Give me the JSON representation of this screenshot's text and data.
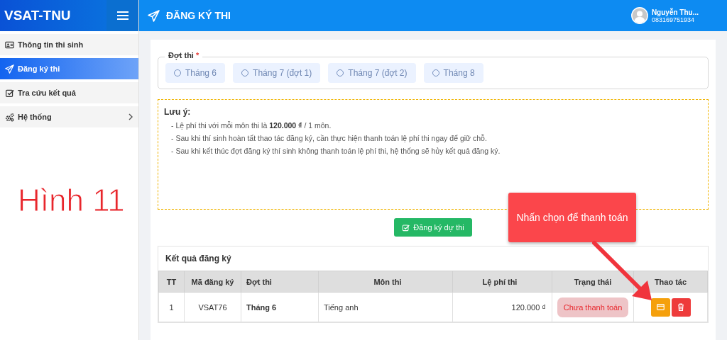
{
  "sidebar": {
    "brand": "VSAT-TNU",
    "items": [
      {
        "label": "Thông tin thi sinh",
        "selected": false,
        "has_submenu": false
      },
      {
        "label": "Đăng ký thi",
        "selected": true,
        "has_submenu": false
      },
      {
        "label": "Tra cứu kết quả",
        "selected": false,
        "has_submenu": false
      },
      {
        "label": "Hệ thống",
        "selected": false,
        "has_submenu": true
      }
    ]
  },
  "header": {
    "title": "ĐĂNG KÝ THI",
    "user": {
      "name": "Nguyễn Thu...",
      "phone": "083169751934"
    }
  },
  "exam_period": {
    "legend": "Đợt thi",
    "required_mark": "*",
    "options": [
      {
        "label": "Tháng 6",
        "selected": false
      },
      {
        "label": "Tháng 7 (đợt 1)",
        "selected": false
      },
      {
        "label": "Tháng 7 (đợt 2)",
        "selected": false
      },
      {
        "label": "Tháng 8",
        "selected": false
      }
    ]
  },
  "notice": {
    "title": "Lưu ý:",
    "lines": [
      "- Lệ phí thi với mỗi môn thi là **120.000 ₫** / 1 môn.",
      "- Sau khi thí sinh hoàn tất thao tác đăng ký, cần thực hiện thanh toán lệ phí thi ngay để giữ chỗ.",
      "- Sau khi kết thúc đợt đăng ký thí sinh không thanh toán lệ phí thi, hệ thống sẽ hủy kết quả đăng ký."
    ]
  },
  "register_button": "Đăng ký dự thi",
  "results": {
    "title": "Kết quả đăng ký",
    "columns": [
      "TT",
      "Mã đăng ký",
      "Đợt thi",
      "Môn thi",
      "Lệ phí thi",
      "Trạng thái",
      "Thao tác"
    ],
    "rows": [
      {
        "index": "1",
        "code": "VSAT76",
        "period": "Tháng 6",
        "subject": "Tiếng anh",
        "fee": "120.000 ₫",
        "status": "Chưa thanh toán",
        "paid": false
      }
    ]
  },
  "annotations": {
    "figure_label": "Hình 11",
    "callout": "Nhấn chọn để thanh toán"
  }
}
